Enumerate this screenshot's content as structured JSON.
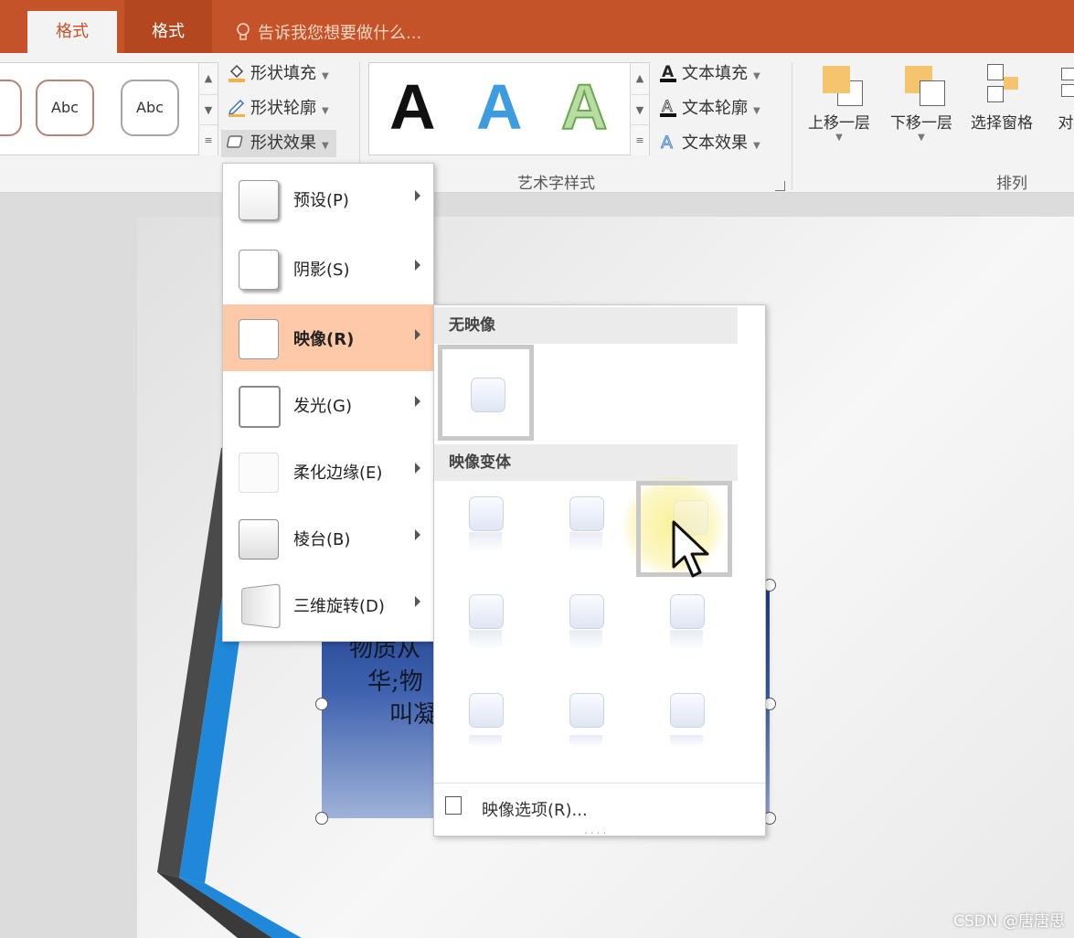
{
  "tabs": {
    "format_active": "格式",
    "format_2": "格式",
    "tell_me": "告诉我您想要做什么..."
  },
  "shape_styles": {
    "sample_1": "Abc",
    "sample_2": "Abc"
  },
  "shape_commands": {
    "fill": "形状填充",
    "outline": "形状轮廓",
    "effects": "形状效果"
  },
  "wordart": {
    "samples": [
      "A",
      "A",
      "A"
    ],
    "fill": "文本填充",
    "outline": "文本轮廓",
    "effects": "文本效果",
    "group_label": "艺术字样式"
  },
  "arrange": {
    "bring_forward": "上移一层",
    "send_backward": "下移一层",
    "selection_pane": "选择窗格",
    "align": "对",
    "group_label": "排列"
  },
  "effects_menu": {
    "items": [
      {
        "label": "预设(P)"
      },
      {
        "label": "阴影(S)"
      },
      {
        "label": "映像(R)"
      },
      {
        "label": "发光(G)"
      },
      {
        "label": "柔化边缘(E)"
      },
      {
        "label": "棱台(B)"
      },
      {
        "label": "三维旋转(D)"
      }
    ],
    "highlighted": "映像(R)"
  },
  "reflection_menu": {
    "no_reflection": "无映像",
    "variations": "映像变体",
    "options": "映像选项(R)..."
  },
  "slide_text": {
    "line1": "物质从",
    "line2": "华;物",
    "line3": "叫凝"
  },
  "watermark": "CSDN @唐唐思",
  "colors": {
    "accent": "#c4532a",
    "highlight": "#fdc9a8",
    "tab_text": "#ffffff"
  }
}
